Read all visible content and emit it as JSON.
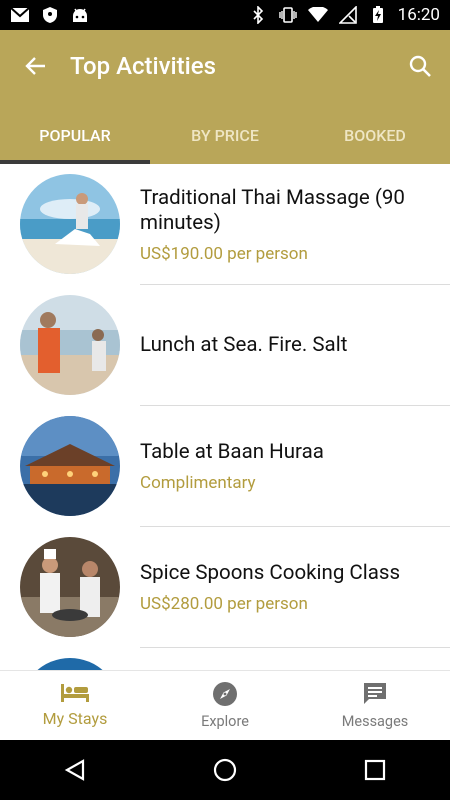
{
  "status_bar": {
    "time": "16:20",
    "left_icons": [
      "gmail-icon",
      "shield-icon",
      "android-icon"
    ],
    "right_icons": [
      "bluetooth-icon",
      "vibrate-icon",
      "wifi-icon",
      "no-signal-icon",
      "battery-charging-icon"
    ]
  },
  "header": {
    "title": "Top Activities",
    "back_icon": "arrow-left-icon",
    "search_icon": "search-icon",
    "color": "#b9a659"
  },
  "tabs": [
    {
      "label": "POPULAR",
      "active": true
    },
    {
      "label": "BY PRICE",
      "active": false
    },
    {
      "label": "BOOKED",
      "active": false
    }
  ],
  "activities": [
    {
      "name": "Traditional Thai Massage (90 minutes)",
      "price": "US$190.00 per person"
    },
    {
      "name": "Lunch at Sea. Fire. Salt",
      "price": ""
    },
    {
      "name": "Table at Baan Huraa",
      "price": "Complimentary"
    },
    {
      "name": "Spice Spoons Cooking Class",
      "price": "US$280.00 per person"
    }
  ],
  "bottom_nav": [
    {
      "label": "My Stays",
      "icon": "bed-icon",
      "active": true
    },
    {
      "label": "Explore",
      "icon": "compass-icon",
      "active": false
    },
    {
      "label": "Messages",
      "icon": "message-icon",
      "active": false
    }
  ],
  "accent_color": "#b29c3e"
}
